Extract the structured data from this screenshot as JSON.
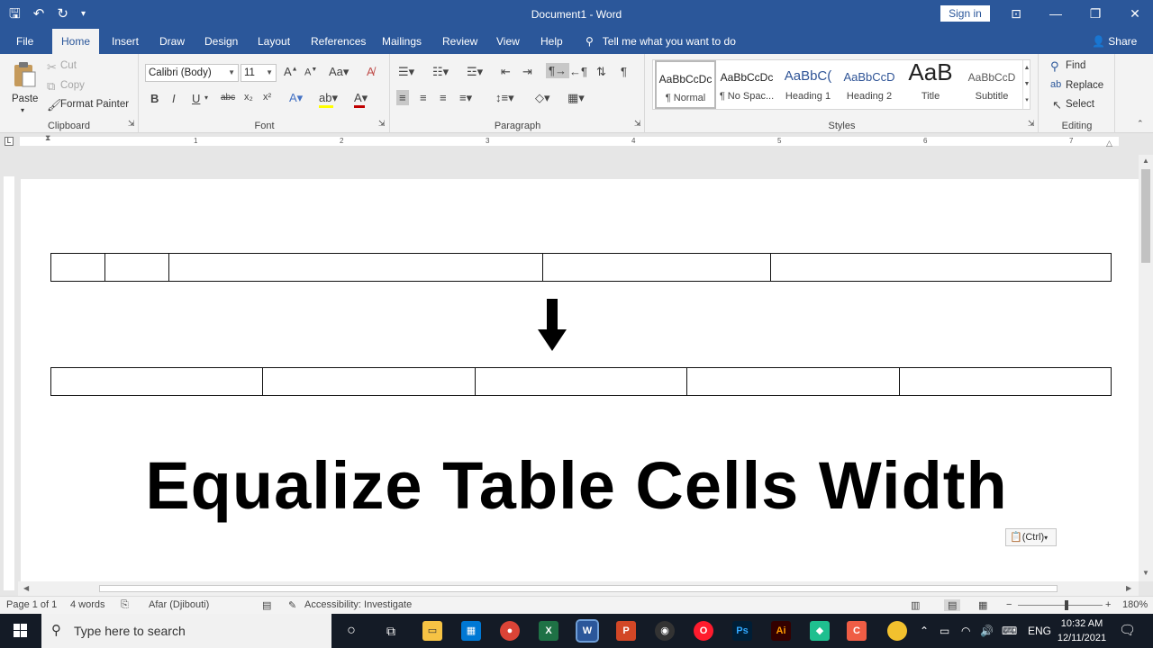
{
  "window": {
    "title": "Document1  -  Word",
    "sign_in": "Sign in",
    "qat": {
      "save_icon": "save-icon",
      "undo_icon": "undo-icon",
      "redo_icon": "redo-icon",
      "customize_icon": "customize-icon"
    }
  },
  "tabs": [
    "File",
    "Home",
    "Insert",
    "Draw",
    "Design",
    "Layout",
    "References",
    "Mailings",
    "Review",
    "View",
    "Help"
  ],
  "active_tab": "Home",
  "tell_me": "Tell me what you want to do",
  "share": "Share",
  "ribbon": {
    "clipboard": {
      "label": "Clipboard",
      "paste": "Paste",
      "cut": "Cut",
      "copy": "Copy",
      "format_painter": "Format Painter"
    },
    "font": {
      "label": "Font",
      "family": "Calibri (Body)",
      "size": "11",
      "bold": "B",
      "italic": "I",
      "underline": "U",
      "strikethrough": "abc",
      "subscript": "x₂",
      "superscript": "x²"
    },
    "paragraph": {
      "label": "Paragraph"
    },
    "styles": {
      "label": "Styles",
      "items": [
        {
          "preview": "AaBbCcDc",
          "name": "¶ Normal"
        },
        {
          "preview": "AaBbCcDc",
          "name": "¶ No Spac..."
        },
        {
          "preview": "AaBbC(",
          "name": "Heading 1"
        },
        {
          "preview": "AaBbCcD",
          "name": "Heading 2"
        },
        {
          "preview": "AaB",
          "name": "Title"
        },
        {
          "preview": "AaBbCcD",
          "name": "Subtitle"
        }
      ]
    },
    "editing": {
      "label": "Editing",
      "find": "Find",
      "replace": "Replace",
      "select": "Select"
    }
  },
  "ruler_numbers": [
    "1",
    "2",
    "3",
    "4",
    "5",
    "6",
    "7"
  ],
  "document": {
    "headline": "Equalize Table Cells Width",
    "paste_options": "(Ctrl)"
  },
  "status": {
    "page": "Page 1 of 1",
    "words": "4 words",
    "language": "Afar (Djibouti)",
    "accessibility": "Accessibility: Investigate",
    "zoom": "180%",
    "zoom_minus": "−",
    "zoom_plus": "+"
  },
  "taskbar": {
    "search_placeholder": "Type here to search",
    "apps": [
      "task-view",
      "file-explorer",
      "store",
      "chrome",
      "excel",
      "word",
      "powerpoint",
      "obs",
      "opera",
      "photoshop",
      "illustrator",
      "filmora",
      "clip-app"
    ],
    "language": "ENG",
    "time": "10:32 AM",
    "date": "12/11/2021"
  },
  "colors": {
    "accent": "#2b579a",
    "taskbar": "#141b26"
  }
}
